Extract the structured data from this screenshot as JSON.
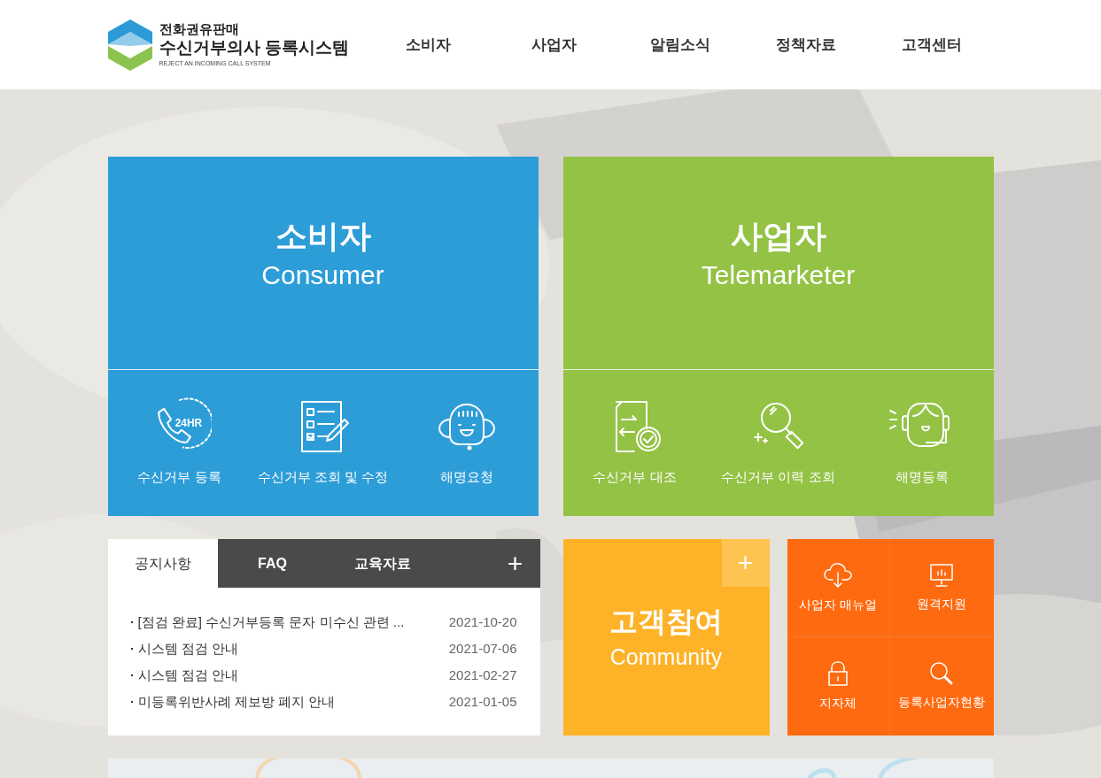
{
  "header": {
    "logo": {
      "top": "전화권유판매",
      "main": "수신거부의사 등록시스템",
      "sub": "REJECT AN INCOMING CALL SYSTEM"
    },
    "nav": [
      "소비자",
      "사업자",
      "알림소식",
      "정책자료",
      "고객센터"
    ]
  },
  "hero": [
    {
      "kind": "consumer",
      "title": "소비자",
      "subtitle": "Consumer",
      "color": "#2d9dd8",
      "links": [
        {
          "label": "수신거부 등록",
          "badge": "24HR"
        },
        {
          "label": "수신거부 조회 및 수정"
        },
        {
          "label": "해명요청"
        }
      ]
    },
    {
      "kind": "telemarketer",
      "title": "사업자",
      "subtitle": "Telemarketer",
      "color": "#93c245",
      "links": [
        {
          "label": "수신거부 대조"
        },
        {
          "label": "수신거부 이력 조회"
        },
        {
          "label": "해명등록"
        }
      ]
    }
  ],
  "notice": {
    "tabs": [
      {
        "label": "공지사항",
        "selected": true
      },
      {
        "label": "FAQ",
        "selected": false
      },
      {
        "label": "교육자료",
        "selected": false
      }
    ],
    "more": "+",
    "items": [
      {
        "title": "[점검 완료] 수신거부등록 문자 미수신 관련 ...",
        "date": "2021-10-20"
      },
      {
        "title": "시스템 점검 안내",
        "date": "2021-07-06"
      },
      {
        "title": "시스템 점검 안내",
        "date": "2021-02-27"
      },
      {
        "title": "미등록위반사례 제보방 폐지 안내",
        "date": "2021-01-05"
      }
    ]
  },
  "community": {
    "title": "고객참여",
    "subtitle": "Community",
    "more": "+"
  },
  "quick_links": [
    {
      "label": "사업자 매뉴얼"
    },
    {
      "label": "원격지원"
    },
    {
      "label": "지자체"
    },
    {
      "label": "등록사업자현황"
    }
  ]
}
